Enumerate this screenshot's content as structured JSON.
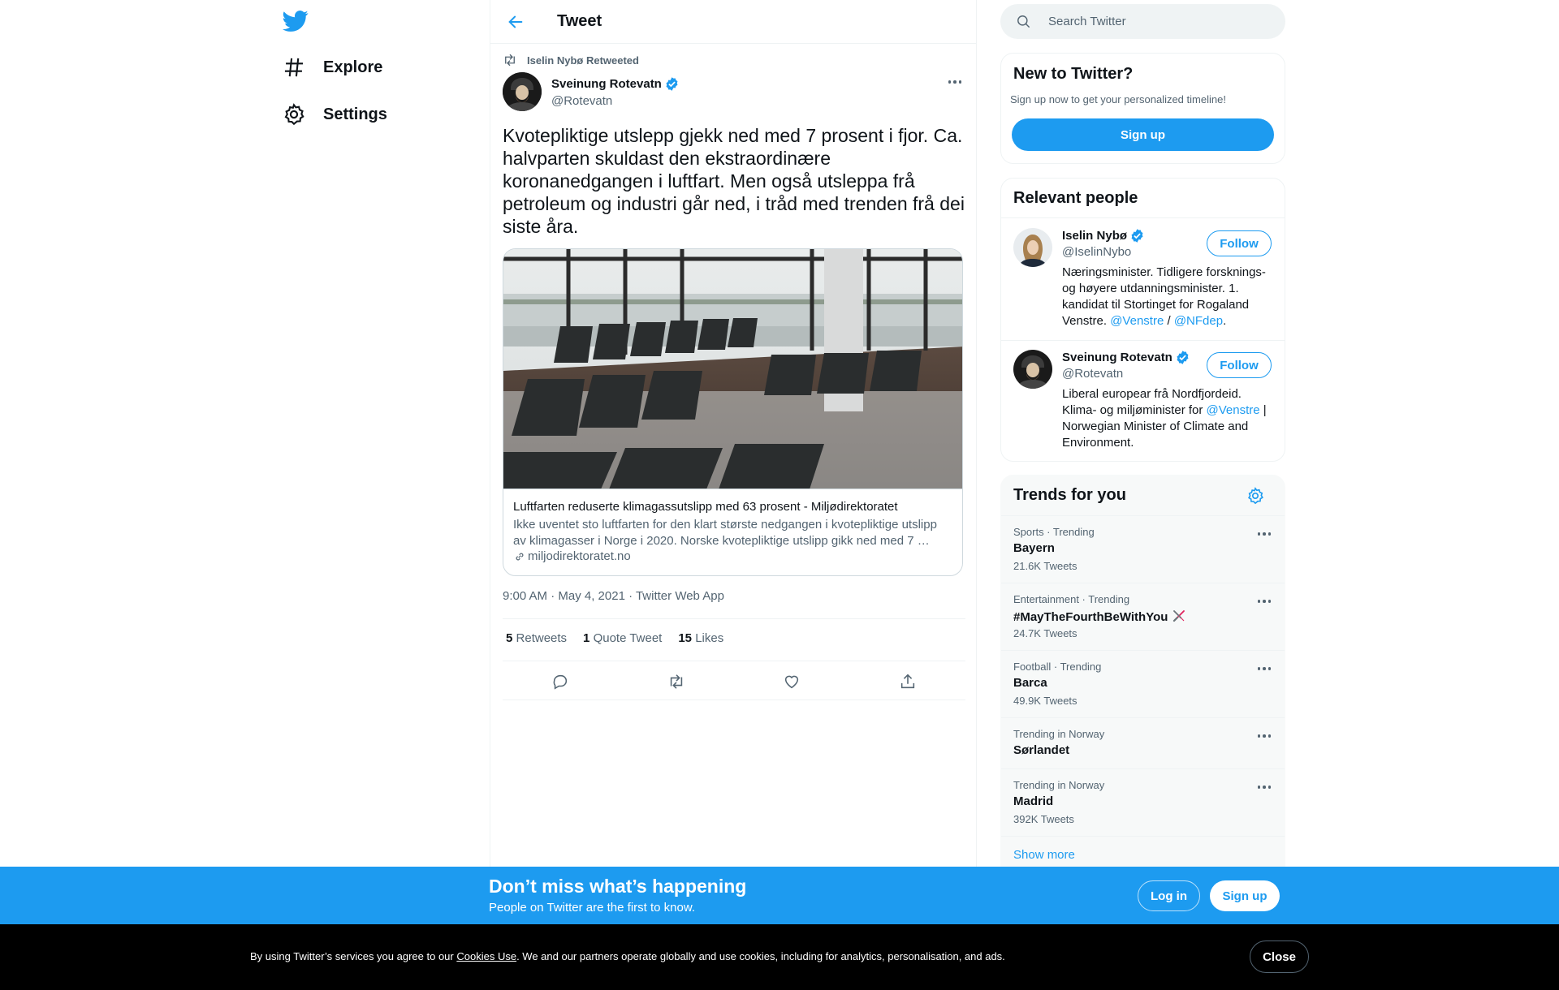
{
  "nav": {
    "logo_icon": "twitter-bird-icon",
    "items": [
      {
        "label": "Explore",
        "icon": "hashtag-icon"
      },
      {
        "label": "Settings",
        "icon": "gear-icon"
      }
    ]
  },
  "header": {
    "title": "Tweet",
    "back_icon": "arrow-left-icon"
  },
  "tweet": {
    "social_context": "Iselin Nybø Retweeted",
    "author": {
      "name": "Sveinung Rotevatn",
      "handle": "@Rotevatn",
      "verified": true
    },
    "text": "Kvotepliktige utslepp gjekk ned med 7 prosent i fjor. Ca. halvparten skuldast den ekstraordinære koronanedgangen i luftfart. Men også utsleppa frå petroleum og industri går ned, i tråd med trenden frå dei siste åra.",
    "card": {
      "title": "Luftfarten reduserte klimagassutslipp med 63 prosent - Miljødirektoratet",
      "description": "Ikke uventet sto luftfarten for den klart største nedgangen i kvotepliktige utslipp av klimagasser i Norge i 2020. Norske kvotepliktige utslipp gikk ned med 7 …",
      "domain": "miljodirektoratet.no"
    },
    "timestamp": "9:00 AM · May 4, 2021 · Twitter Web App",
    "stats": {
      "retweets_count": "5",
      "retweets_label": "Retweets",
      "quotes_count": "1",
      "quotes_label": "Quote Tweet",
      "likes_count": "15",
      "likes_label": "Likes"
    },
    "actions": [
      "reply-icon",
      "retweet-icon",
      "like-icon",
      "share-icon"
    ]
  },
  "search": {
    "placeholder": "Search Twitter"
  },
  "new_to_twitter": {
    "title": "New to Twitter?",
    "subtitle": "Sign up now to get your personalized timeline!",
    "signup_label": "Sign up"
  },
  "relevant_people": {
    "title": "Relevant people",
    "people": [
      {
        "name": "Iselin Nybø",
        "handle": "@IselinNybo",
        "follow_label": "Follow",
        "bio_text": "Næringsminister. Tidligere forsknings- og høyere utdanningsminister. 1. kandidat til Stortinget for Rogaland Venstre. ",
        "bio_link1": "@Venstre",
        "bio_sep": " / ",
        "bio_link2": "@NFdep",
        "bio_end": "."
      },
      {
        "name": "Sveinung Rotevatn",
        "handle": "@Rotevatn",
        "follow_label": "Follow",
        "bio_text": "Liberal europear frå Nordfjordeid. Klima- og miljøminister for ",
        "bio_link1": "@Venstre",
        "bio_end": " | Norwegian Minister of Climate and Environment."
      }
    ]
  },
  "trends": {
    "title": "Trends for you",
    "settings_icon": "gear-icon",
    "items": [
      {
        "context": "Sports · Trending",
        "name": "Bayern",
        "count": "21.6K Tweets"
      },
      {
        "context": "Entertainment · Trending",
        "name": "#MayTheFourthBeWithYou",
        "count": "24.7K Tweets"
      },
      {
        "context": "Football · Trending",
        "name": "Barca",
        "count": "49.9K Tweets"
      },
      {
        "context": "Trending in Norway",
        "name": "Sørlandet",
        "count": ""
      },
      {
        "context": "Trending in Norway",
        "name": "Madrid",
        "count": "392K Tweets"
      }
    ],
    "show_more": "Show more"
  },
  "bottom_bar": {
    "title": "Don’t miss what’s happening",
    "subtitle": "People on Twitter are the first to know.",
    "login_label": "Log in",
    "signup_label": "Sign up"
  },
  "cookie_bar": {
    "text_before": "By using Twitter’s services you agree to our ",
    "link": "Cookies Use",
    "text_after": ". We and our partners operate globally and use cookies, including for analytics, personalisation, and ads.",
    "close_label": "Close"
  },
  "colors": {
    "accent": "#1d9bf0",
    "text": "#0f1419",
    "muted": "#536471",
    "border": "#eff3f4"
  }
}
